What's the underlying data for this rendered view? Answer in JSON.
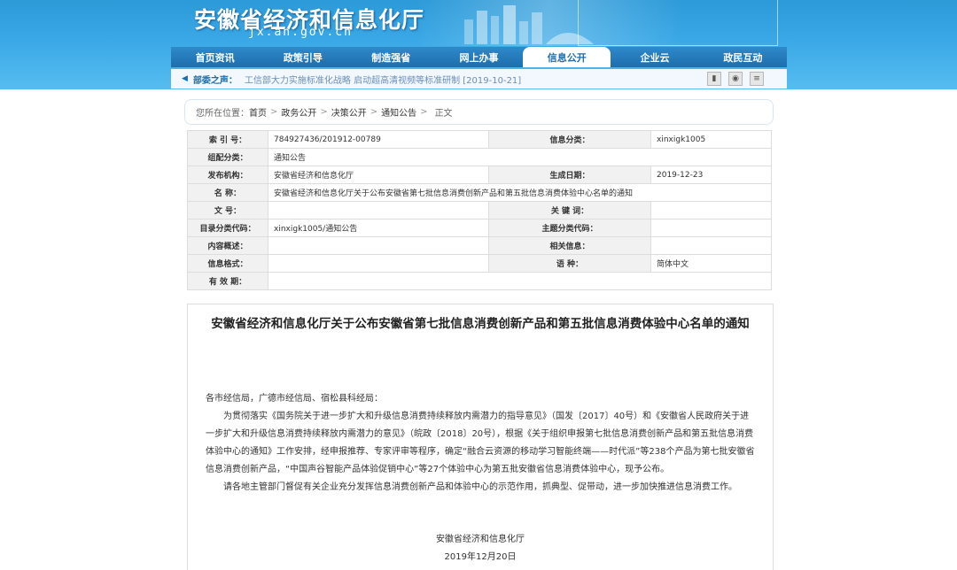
{
  "site": {
    "name": "安徽省经济和信息化厅",
    "domain": "jx.ah.gov.cn"
  },
  "nav": [
    {
      "label": "首页资讯"
    },
    {
      "label": "政策引导"
    },
    {
      "label": "制造强省"
    },
    {
      "label": "网上办事"
    },
    {
      "label": "信息公开",
      "active": true
    },
    {
      "label": "企业云"
    },
    {
      "label": "政民互动"
    }
  ],
  "ticker": {
    "label": "部委之声：",
    "message": "工信部大力实施标准化战略 启动超高清视频等标准研制 [2019-10-21]",
    "tools": [
      "bookmark-icon",
      "camera-icon",
      "list-icon"
    ]
  },
  "breadcrumb": {
    "prefix": "您所在位置：",
    "items": [
      "首页",
      "政务公开",
      "决策公开",
      "通知公告",
      "正文"
    ]
  },
  "meta": {
    "index_no_label": "索 引 号：",
    "index_no": "784927436/201912-00789",
    "info_category_label": "信息分类：",
    "info_category": "xinxigk1005",
    "topic_label": "组配分类：",
    "topic": "通知公告",
    "publisher_label": "发布机构：",
    "publisher": "安徽省经济和信息化厅",
    "date_label": "生成日期：",
    "date": "2019-12-23",
    "name_label": "名      称：",
    "name": "安徽省经济和信息化厅关于公布安徽省第七批信息消费创新产品和第五批信息消费体验中心名单的通知",
    "doc_no_label": "文      号：",
    "doc_no": "",
    "keywords_label": "关 键 词：",
    "keywords": "",
    "catalog_label": "目录分类代码：",
    "catalog": "xinxigk1005/通知公告",
    "subject_code_label": "主题分类代码：",
    "subject_code": "",
    "summary_label": "内容概述：",
    "summary": "",
    "related_label": "相关信息：",
    "related": "",
    "format_label": "信息格式：",
    "format": "",
    "language_label": "语      种：",
    "language": "简体中文",
    "validity_label": "有 效 期：",
    "validity": ""
  },
  "article": {
    "title": "安徽省经济和信息化厅关于公布安徽省第七批信息消费创新产品和第五批信息消费体验中心名单的通知",
    "salutation": "各市经信局，广德市经信局、宿松县科经局：",
    "para1": "为贯彻落实《国务院关于进一步扩大和升级信息消费持续释放内需潜力的指导意见》（国发〔2017〕40号）和《安徽省人民政府关于进一步扩大和升级信息消费持续释放内需潜力的意见》（皖政〔2018〕20号），根据《关于组织申报第七批信息消费创新产品和第五批信息消费体验中心的通知》工作安排，经申报推荐、专家评审等程序，确定“融合云资源的移动学习智能终端——时代派”等238个产品为第七批安徽省信息消费创新产品，“中国声谷智能产品体验促销中心”等27个体验中心为第五批安徽省信息消费体验中心，现予公布。",
    "para2": "请各地主管部门督促有关企业充分发挥信息消费创新产品和体验中心的示范作用，抓典型、促带动，进一步加快推进信息消费工作。",
    "signer": "安徽省经济和信息化厅",
    "sign_date": "2019年12月20日"
  }
}
